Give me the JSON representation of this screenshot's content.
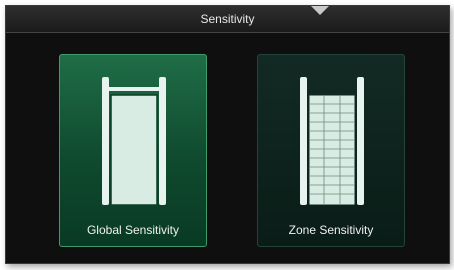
{
  "window": {
    "title": "Sensitivity"
  },
  "options": {
    "global": {
      "label": "Global Sensitivity",
      "icon": "gate-single-zone-icon",
      "selected": true
    },
    "zone": {
      "label": "Zone Sensitivity",
      "icon": "gate-multi-zone-icon",
      "selected": false
    }
  },
  "colors": {
    "selected_card": "#1f6d47",
    "unselected_card": "#132a24",
    "background": "#0f0f0f"
  }
}
